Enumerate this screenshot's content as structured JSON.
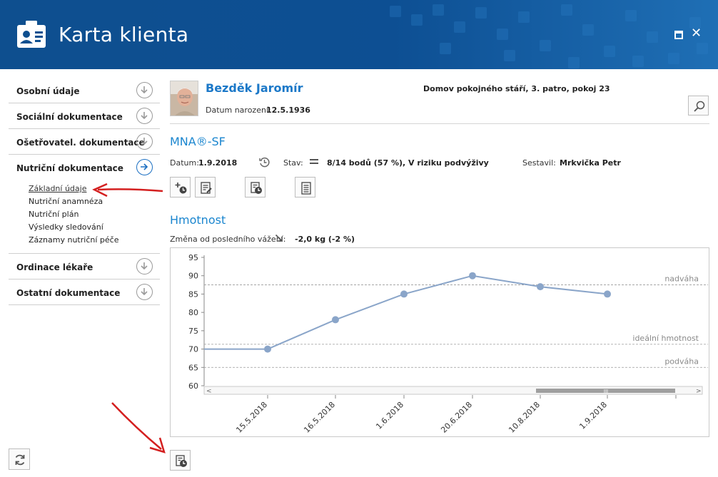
{
  "window": {
    "title": "Karta klienta",
    "maximize_icon": "maximize-icon",
    "close_label": "✕"
  },
  "sidebar": {
    "items": [
      {
        "label": "Osobní údaje"
      },
      {
        "label": "Sociální dokumentace"
      },
      {
        "label": "Ošetřovatel. dokumentace"
      },
      {
        "label": "Nutriční dokumentace"
      },
      {
        "label": "Ordinace lékaře"
      },
      {
        "label": "Ostatní dokumentace"
      }
    ],
    "subitems": [
      {
        "label": "Základní údaje"
      },
      {
        "label": "Nutriční anamnéza"
      },
      {
        "label": "Nutriční plán"
      },
      {
        "label": "Výsledky sledování"
      },
      {
        "label": "Záznamy nutriční péče"
      }
    ]
  },
  "client": {
    "name": "Bezděk Jaromír",
    "dob_label": "Datum narození:",
    "dob": "12.5.1936",
    "location": "Domov pokojného stáří, 3. patro, pokoj 23"
  },
  "mna": {
    "title": "MNA®-SF",
    "date_label": "Datum:",
    "date": "1.9.2018",
    "state_label": "Stav:",
    "state": "8/14 bodů (57 %), V riziku podvýživy",
    "author_label": "Sestavil:",
    "author": "Mrkvička Petr"
  },
  "weight": {
    "title": "Hmotnost",
    "change_label": "Změna od posledního vážení:",
    "change_value": "-2,0 kg (-2 %)"
  },
  "chart_data": {
    "type": "line",
    "categories": [
      "15.5.2018",
      "16.5.2018",
      "1.6.2018",
      "20.6.2018",
      "10.8.2018",
      "1.9.2018"
    ],
    "values": [
      70,
      78,
      85,
      90,
      87,
      85
    ],
    "ylim": [
      60,
      95
    ],
    "yticks": [
      60,
      65,
      70,
      75,
      80,
      85,
      90,
      95
    ],
    "reference_lines": [
      {
        "label": "nadváha",
        "value": 87.5
      },
      {
        "label": "ideální hmotnost",
        "value": 71.3
      },
      {
        "label": "podváha",
        "value": 65
      }
    ],
    "grid": false,
    "line_color": "#8aa5c9",
    "scrollbar_glyph": "III"
  },
  "colors": {
    "accent": "#1b86cf",
    "header": "#0e4f8f",
    "annotation_arrow": "#d42020"
  }
}
